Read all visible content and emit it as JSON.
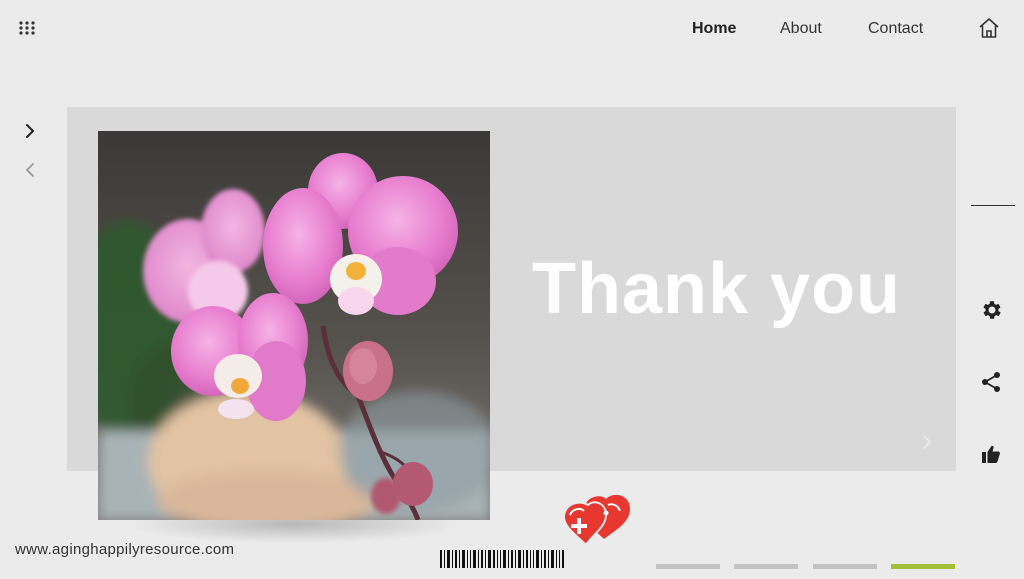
{
  "header": {
    "menu_icon": "grid-menu-icon",
    "nav": [
      {
        "label": "Home",
        "active": true
      },
      {
        "label": "About",
        "active": false
      },
      {
        "label": "Contact",
        "active": false
      }
    ],
    "home_icon": "home-icon"
  },
  "slide": {
    "heading": "Thank you",
    "image_subject": "pink-orchid-photo"
  },
  "side_icons": [
    "settings-gear-icon",
    "share-icon",
    "thumbs-up-icon"
  ],
  "footer": {
    "website": "www.aginghappilyresource.com",
    "logo": "heart-logo",
    "progress": {
      "total": 4,
      "current": 4
    }
  },
  "colors": {
    "background": "#ebebeb",
    "card": "#d9d9d9",
    "accent": "#a3bf3a",
    "heart": "#e8372f",
    "orchid": "#e882c9"
  }
}
